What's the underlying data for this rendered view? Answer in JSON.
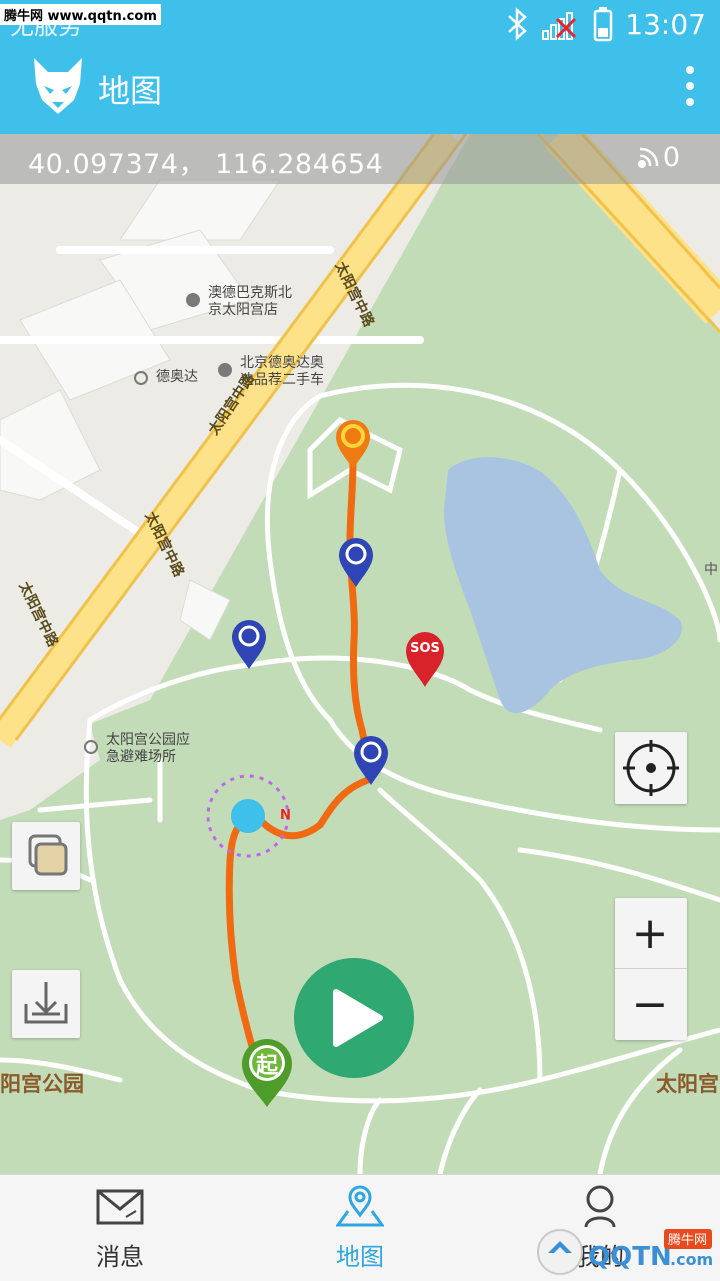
{
  "status": {
    "carrier": "无服务",
    "time": "13:07",
    "watermark": "腾牛网 www.qqtn.com"
  },
  "appbar": {
    "title": "地图",
    "logo_icon": "wolf-logo-icon",
    "menu_icon": "more-vert-icon"
  },
  "coords": {
    "text": "40.097374， 116.284654",
    "count": "0"
  },
  "map_labels": {
    "poi1": "北京德奥达奥\n迪品荐二手车",
    "poi2": "澳德巴克斯北\n京太阳宫店",
    "poi3": "德奥达",
    "poi4": "太阳宫公园应\n急避难场所",
    "road1": "太阳宫中路",
    "road2": "太阳宫中路",
    "road3": "太阳宫中路",
    "road4": "太阳宫中路",
    "park_left": "阳宫公园",
    "park_right": "太阳宫",
    "edge": "中"
  },
  "markers": {
    "sos": "SOS",
    "start": "起",
    "compass": "N"
  },
  "controls": {
    "zoom_in": "+",
    "zoom_out": "−"
  },
  "nav": {
    "items": [
      {
        "label": "消息",
        "icon": "mail-icon"
      },
      {
        "label": "地图",
        "icon": "map-pin-icon"
      },
      {
        "label": "我的",
        "icon": "person-icon"
      }
    ]
  },
  "colors": {
    "primary": "#3ec0ea",
    "route": "#f06a12",
    "play": "#2fa871",
    "sos": "#d9232a",
    "marker_blue": "#2f45b5",
    "marker_orange": "#f07a12",
    "start_green": "#4e9c2a"
  },
  "brand_mark": "QQTN.com 腾牛网"
}
